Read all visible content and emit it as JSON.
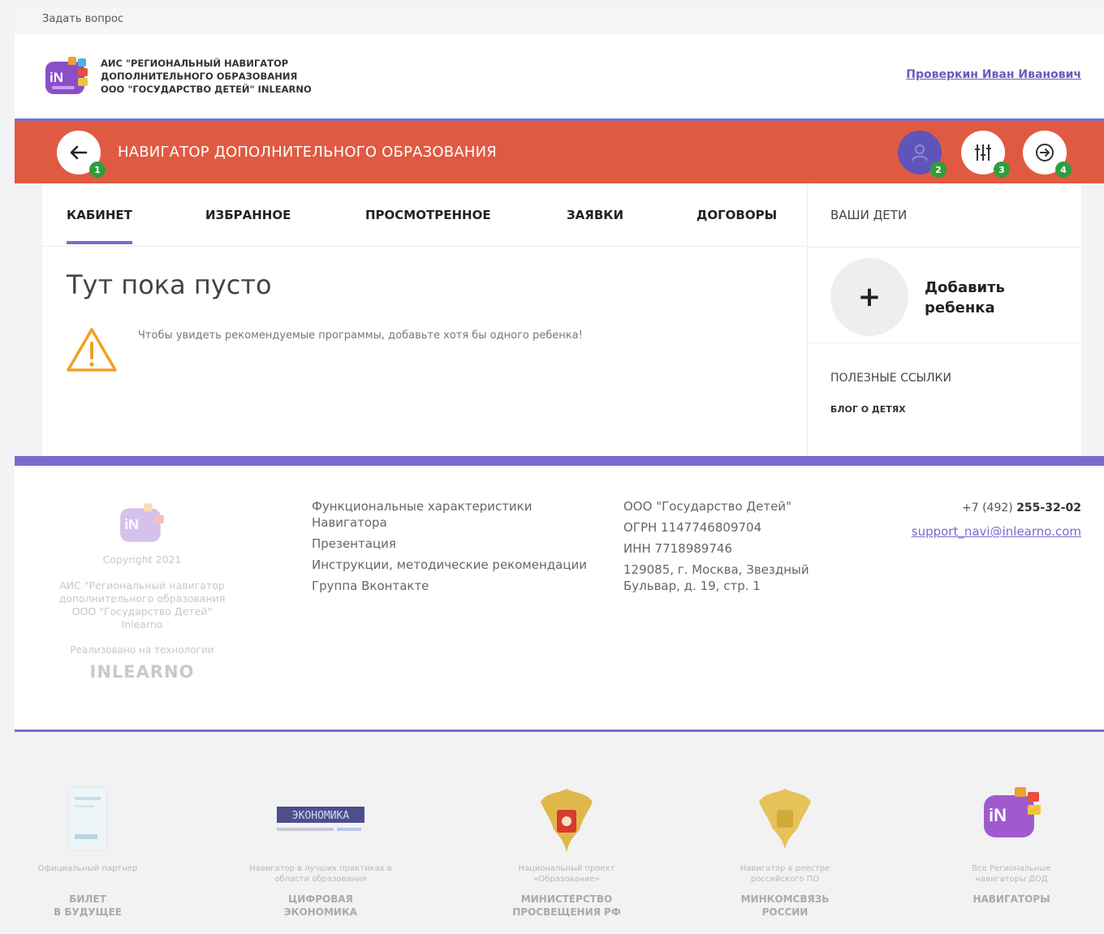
{
  "top_bar": {
    "ask_question": "Задать вопрос"
  },
  "header": {
    "org_lines": [
      "АИС \"РЕГИОНАЛЬНЫЙ НАВИГАТОР",
      "ДОПОЛНИТЕЛЬНОГО ОБРАЗОВАНИЯ",
      "ООО \"ГОСУДАРСТВО ДЕТЕЙ\" INLEARNO"
    ],
    "user_name": "Проверкин Иван Иванович"
  },
  "navbar": {
    "title": "НАВИГАТОР ДОПОЛНИТЕЛЬНОГО ОБРАЗОВАНИЯ",
    "badges": {
      "back": "1",
      "profile": "2",
      "filters": "3",
      "logout": "4"
    },
    "colors": {
      "bar": "#e05a42",
      "accent": "#7b6ad0",
      "badge": "#2e9e3c"
    }
  },
  "tabs": [
    {
      "label": "КАБИНЕТ",
      "active": true
    },
    {
      "label": "ИЗБРАННОЕ"
    },
    {
      "label": "ПРОСМОТРЕННОЕ"
    },
    {
      "label": "ЗАЯВКИ"
    },
    {
      "label": "ДОГОВОРЫ"
    }
  ],
  "main": {
    "empty_title": "Тут пока пусто",
    "warning_text": "Чтобы увидеть рекомендуемые программы, добавьте хотя бы одного ребенка!"
  },
  "sidebar": {
    "heading": "ВАШИ ДЕТИ",
    "add_symbol": "+",
    "add_label_lines": [
      "Добавить",
      "ребенка"
    ],
    "links_heading": "ПОЛЕЗНЫЕ ССЫЛКИ",
    "blog_link": "БЛОГ О ДЕТЯХ"
  },
  "footer": {
    "copyright": "Copyright 2021",
    "org_lines": [
      "АИС \"Региональный навигатор",
      "дополнительного образования",
      "ООО \"Государство Детей\"",
      "Inlearno"
    ],
    "tech_label": "Реализовано на технологии",
    "tech_brand": "INLEARNO",
    "links": [
      "Функциональные характеристики Навигатора",
      "Презентация",
      "Инструкции, методические рекомендации",
      "Группа Вконтакте"
    ],
    "legal": [
      "ООО \"Государство Детей\"",
      "ОГРН 1147746809704",
      "ИНН 7718989746",
      "129085, г. Москва, Звездный Бульвар, д. 19, стр. 1"
    ],
    "phone_prefix": "+7 (492)",
    "phone_number": "255-32-02",
    "email": "support_navi@inlearno.com"
  },
  "partners": [
    {
      "desc": "Официальный партнер",
      "name_lines": [
        "БИЛЕТ",
        "В БУДУЩЕЕ"
      ],
      "icon": "ticket-future-logo"
    },
    {
      "desc": "Навигатор в лучших практиках в области образования",
      "name_lines": [
        "ЦИФРОВАЯ",
        "ЭКОНОМИКА"
      ],
      "icon": "digital-economy-logo",
      "logo_text": "ЭКОНОМИКА"
    },
    {
      "desc": "Национальный проект «Образование»",
      "name_lines": [
        "МИНИСТЕРСТВО",
        "ПРОСВЕЩЕНИЯ РФ"
      ],
      "icon": "coat-of-arms-red"
    },
    {
      "desc": "Навигатор в реестре российского ПО",
      "name_lines": [
        "МИНКОМСВЯЗЬ",
        "РОССИИ"
      ],
      "icon": "coat-of-arms-gold"
    },
    {
      "desc": "Все Региональные навигаторы ДОД",
      "name_lines": [
        "НАВИГАТОРЫ"
      ],
      "icon": "navigators-logo"
    }
  ]
}
